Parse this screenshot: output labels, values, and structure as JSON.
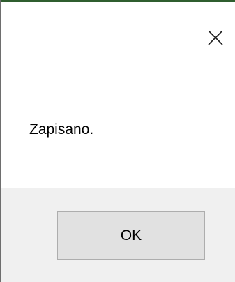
{
  "dialog": {
    "message": "Zapisano.",
    "ok_label": "OK",
    "close_icon": "close-icon"
  }
}
